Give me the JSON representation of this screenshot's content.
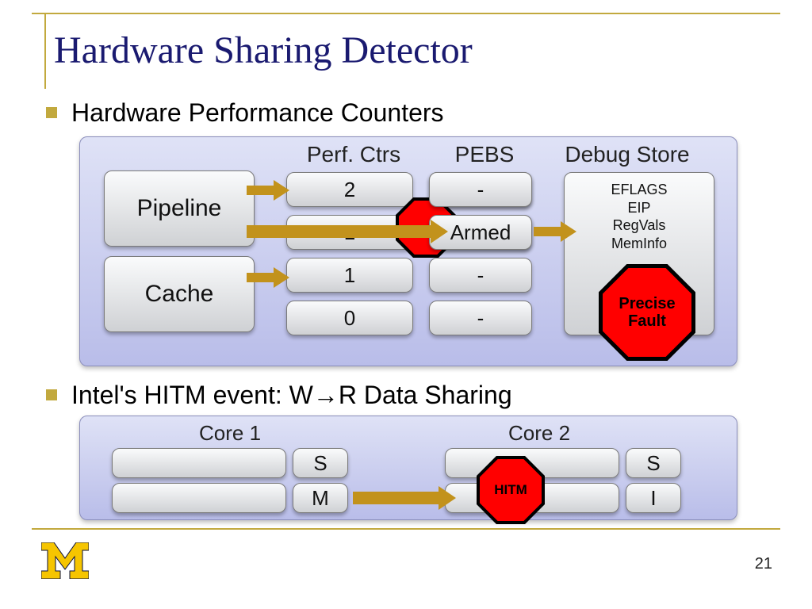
{
  "title": "Hardware Sharing Detector",
  "bullet1": "Hardware Performance Counters",
  "bullet2": "Intel's HITM event: W→R Data Sharing",
  "panel1": {
    "headers": {
      "perfctrs": "Perf. Ctrs",
      "pebs": "PEBS",
      "debug": "Debug Store"
    },
    "leftBoxes": {
      "pipeline": "Pipeline",
      "cache": "Cache"
    },
    "perfValues": [
      "2",
      "1",
      "1",
      "0"
    ],
    "pebsValues": [
      "-",
      "Armed",
      "-",
      "-"
    ],
    "debugText": [
      "EFLAGS",
      "EIP",
      "RegVals",
      "MemInfo"
    ],
    "fault": "Precise\nFault"
  },
  "panel2": {
    "core1": "Core 1",
    "core2": "Core 2",
    "states1": [
      "S",
      "M"
    ],
    "states2": [
      "S",
      "I"
    ],
    "hitm": "HITM"
  },
  "page": "21"
}
